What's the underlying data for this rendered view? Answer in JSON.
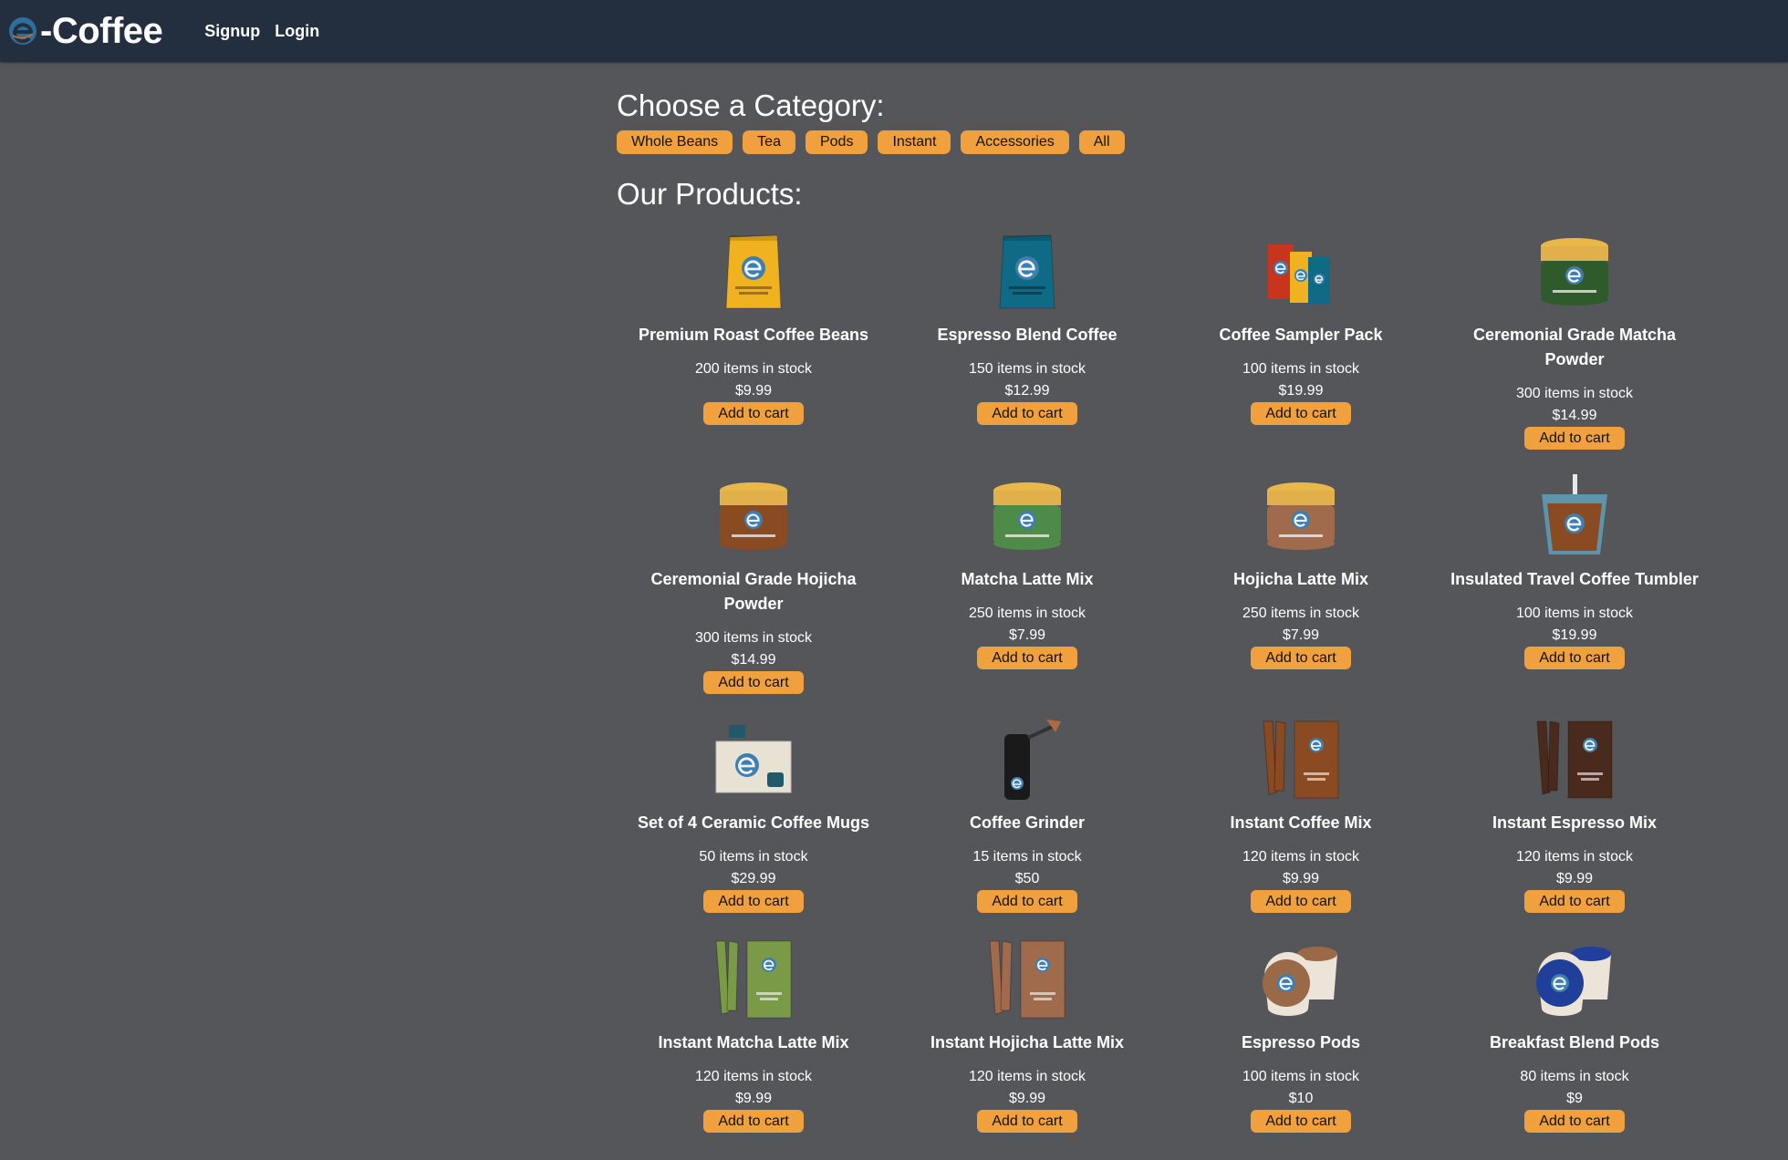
{
  "app": {
    "logo_text": "-Coffee",
    "nav": {
      "signup": "Signup",
      "login": "Login"
    }
  },
  "category_section": {
    "heading": "Choose a Category:",
    "categories": [
      "Whole Beans",
      "Tea",
      "Pods",
      "Instant",
      "Accessories",
      "All"
    ]
  },
  "products_section": {
    "heading": "Our Products:",
    "add_label": "Add to cart",
    "products": [
      {
        "name": "Premium Roast Coffee Beans",
        "stock": "200 items in stock",
        "price": "$9.99",
        "icon": "coffee-bag-icon",
        "color": "#f1b21f"
      },
      {
        "name": "Espresso Blend Coffee",
        "stock": "150 items in stock",
        "price": "$12.99",
        "icon": "coffee-bag-icon",
        "color": "#0f6a86"
      },
      {
        "name": "Coffee Sampler Pack",
        "stock": "100 items in stock",
        "price": "$19.99",
        "icon": "sampler-pack-icon",
        "color": "#c9341f"
      },
      {
        "name": "Ceremonial Grade Matcha Powder",
        "stock": "300 items in stock",
        "price": "$14.99",
        "icon": "jar-icon",
        "color": "#2f5a2c"
      },
      {
        "name": "Ceremonial Grade Hojicha Powder",
        "stock": "300 items in stock",
        "price": "$14.99",
        "icon": "jar-icon",
        "color": "#8a4a22"
      },
      {
        "name": "Matcha Latte Mix",
        "stock": "250 items in stock",
        "price": "$7.99",
        "icon": "jar-icon",
        "color": "#4e8a48"
      },
      {
        "name": "Hojicha Latte Mix",
        "stock": "250 items in stock",
        "price": "$7.99",
        "icon": "jar-icon",
        "color": "#a06a4c"
      },
      {
        "name": "Insulated Travel Coffee Tumbler",
        "stock": "100 items in stock",
        "price": "$19.99",
        "icon": "tumbler-icon",
        "color": "#8a4a22"
      },
      {
        "name": "Set of 4 Ceramic Coffee Mugs",
        "stock": "50 items in stock",
        "price": "$29.99",
        "icon": "mug-set-icon",
        "color": "#e8e2d4"
      },
      {
        "name": "Coffee Grinder",
        "stock": "15 items in stock",
        "price": "$50",
        "icon": "grinder-icon",
        "color": "#1a1a1a"
      },
      {
        "name": "Instant Coffee Mix",
        "stock": "120 items in stock",
        "price": "$9.99",
        "icon": "instant-sticks-icon",
        "color": "#8a4a22"
      },
      {
        "name": "Instant Espresso Mix",
        "stock": "120 items in stock",
        "price": "$9.99",
        "icon": "instant-sticks-icon",
        "color": "#4a2a1c"
      },
      {
        "name": "Instant Matcha Latte Mix",
        "stock": "120 items in stock",
        "price": "$9.99",
        "icon": "instant-sticks-icon",
        "color": "#7a9a48"
      },
      {
        "name": "Instant Hojicha Latte Mix",
        "stock": "120 items in stock",
        "price": "$9.99",
        "icon": "instant-sticks-icon",
        "color": "#a06a4c"
      },
      {
        "name": "Espresso Pods",
        "stock": "100 items in stock",
        "price": "$10",
        "icon": "pods-icon",
        "color": "#9a6a48"
      },
      {
        "name": "Breakfast Blend Pods",
        "stock": "80 items in stock",
        "price": "$9",
        "icon": "pods-icon",
        "color": "#1f3f9a"
      }
    ]
  }
}
